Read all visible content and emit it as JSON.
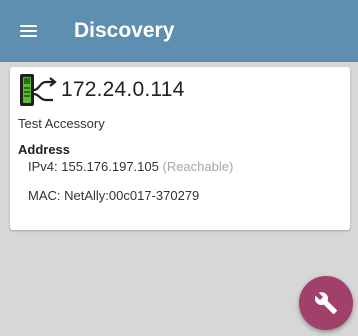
{
  "appbar": {
    "title": "Discovery",
    "menu_icon": "hamburger-menu-icon"
  },
  "device": {
    "icon": "netally-tester-icon",
    "ip": "172.24.0.114",
    "name": "Test Accessory",
    "address_heading": "Address",
    "ipv4_label": "IPv4:",
    "ipv4_value": "155.176.197.105",
    "ipv4_status": "(Reachable)",
    "mac_label": "MAC:",
    "mac_value": "NetAlly:00c017-370279"
  },
  "fab": {
    "icon": "wrench-icon"
  },
  "colors": {
    "appbar": "#5f8fb0",
    "fab": "#a1406b",
    "background": "#d7d7d7"
  }
}
